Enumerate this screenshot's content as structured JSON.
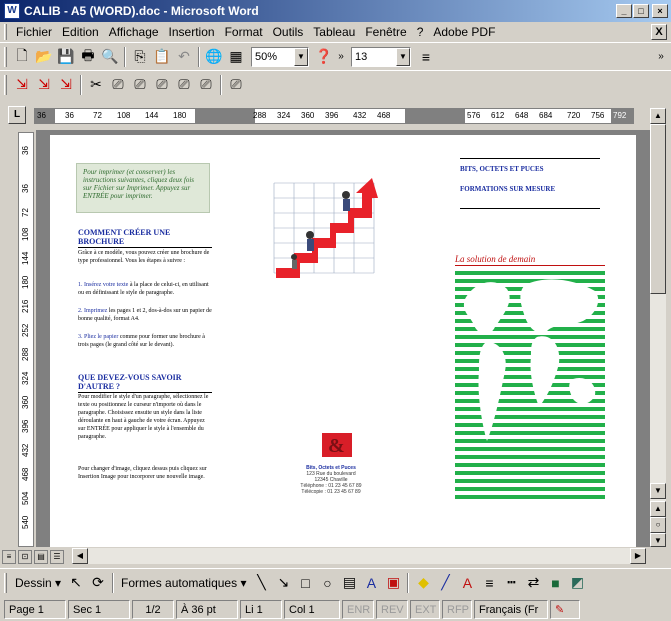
{
  "window": {
    "title": "CALIB - A5 (WORD).doc - Microsoft Word",
    "app_icon": "W"
  },
  "menu": {
    "items": [
      "Fichier",
      "Edition",
      "Affichage",
      "Insertion",
      "Format",
      "Outils",
      "Tableau",
      "Fenêtre",
      "?",
      "Adobe PDF"
    ],
    "close_glyph": "X"
  },
  "toolbar": {
    "zoom_value": "50%",
    "font_size_value": "13"
  },
  "ruler": {
    "corner": "L",
    "h_ticks": [
      "36",
      "36",
      "72",
      "108",
      "144",
      "180",
      "288",
      "324",
      "360",
      "396",
      "432",
      "468",
      "576",
      "612",
      "648",
      "684",
      "720",
      "756",
      "792"
    ],
    "v_ticks": [
      "36",
      "36",
      "72",
      "108",
      "144",
      "180",
      "216",
      "252",
      "288",
      "324",
      "360",
      "396",
      "432",
      "468",
      "504",
      "540"
    ]
  },
  "document": {
    "intro_text": "Pour imprimer (et conserver) les instructions suivantes, cliquez deux fois sur Fichier sur Imprimer. Appuyez sur ENTRÉE pour imprimer.",
    "heading1": "COMMENT CRÉER UNE BROCHURE",
    "para1": "Grâce à ce modèle, vous pouvez créer une brochure de type professionnel. Vous les étapes à suivre :",
    "step1_hl": "1. Insérez votre texte",
    "step1": " à la place de celui-ci, en utilisant ou en définissant le style de paragraphe.",
    "step2_hl": "2. Imprimez",
    "step2": " les pages 1 et 2, dos-à-dos sur un papier de bonne qualité, format A4.",
    "step3_hl": "3. Pliez le papier",
    "step3": " comme pour former une brochure à trois pages (le grand côté sur le devant).",
    "heading2": "QUE DEVEZ-VOUS SAVOIR D'AUTRE ?",
    "para2": "Pour modifier le style d'un paragraphe, sélectionnez le texte ou positionnez le curseur n'importe où dans le paragraphe. Choisissez ensuite un style dans la liste déroulante en haut à gauche de votre écran. Appuyez sur ENTRÉE pour appliquer le style à l'ensemble du paragraphe.",
    "para3": "Pour changer d'image, cliquez dessus puis cliquez sur Insertion Image pour incorporer une nouvelle image.",
    "right_head1": "BITS, OCTETS ET PUCES",
    "right_head2": "FORMATIONS SUR MESURE",
    "slogan": "La solution de demain",
    "company_name": "Bits, Octets et Puces",
    "company_addr1": "123 Rue du boulevard",
    "company_addr2": "12345 Chaville",
    "company_tel": "Téléphone : 01 23 45 67 89",
    "company_fax": "Télécopie : 01 23 45 67 89"
  },
  "drawbar": {
    "draw_label": "Dessin",
    "autoshapes_label": "Formes automatiques"
  },
  "status": {
    "page": "Page 1",
    "section": "Sec 1",
    "pages": "1/2",
    "at": "À 36 pt",
    "line": "Li 1",
    "col": "Col 1",
    "enr": "ENR",
    "rev": "REV",
    "ext": "EXT",
    "rfp": "RFP",
    "lang": "Français (Fr"
  },
  "colors": {
    "title_blue": "#1a2da0",
    "accent_red": "#c01010",
    "map_green": "#22b04a"
  }
}
